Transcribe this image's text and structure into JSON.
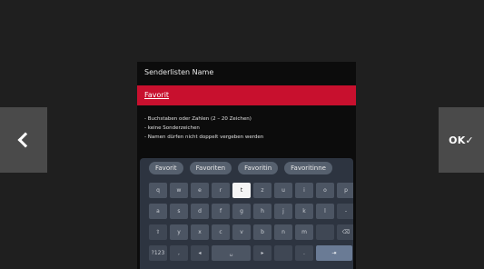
{
  "nav": {
    "prev_icon": "chevron-left-icon",
    "ok_label": "OK✓"
  },
  "dialog": {
    "title": "Senderlisten Name",
    "name_value": "Favorit",
    "rules": [
      "- Buchstaben oder Zahlen (2 – 20 Zeichen)",
      "- keine Sonderzeichen",
      "- Namen dürfen nicht doppelt vergeben werden"
    ]
  },
  "keyboard": {
    "suggestions": [
      "Favorit",
      "Favoriten",
      "Favoritin",
      "Favoritinne"
    ],
    "row1": [
      "q",
      "w",
      "e",
      "r",
      "t",
      "z",
      "u",
      "i",
      "o",
      "p"
    ],
    "row2": [
      "a",
      "s",
      "d",
      "f",
      "g",
      "h",
      "j",
      "k",
      "l",
      "-"
    ],
    "row3": [
      "⇧",
      "y",
      "x",
      "c",
      "v",
      "b",
      "n",
      "m",
      "",
      "⌫"
    ],
    "row4": [
      "?123",
      ",",
      "◂",
      "␣",
      "▸",
      "",
      ".",
      "⇥"
    ],
    "active_key": "t",
    "colors": {
      "accent": "#c8102e",
      "key": "#4c5563",
      "panel": "#2d3440"
    }
  }
}
